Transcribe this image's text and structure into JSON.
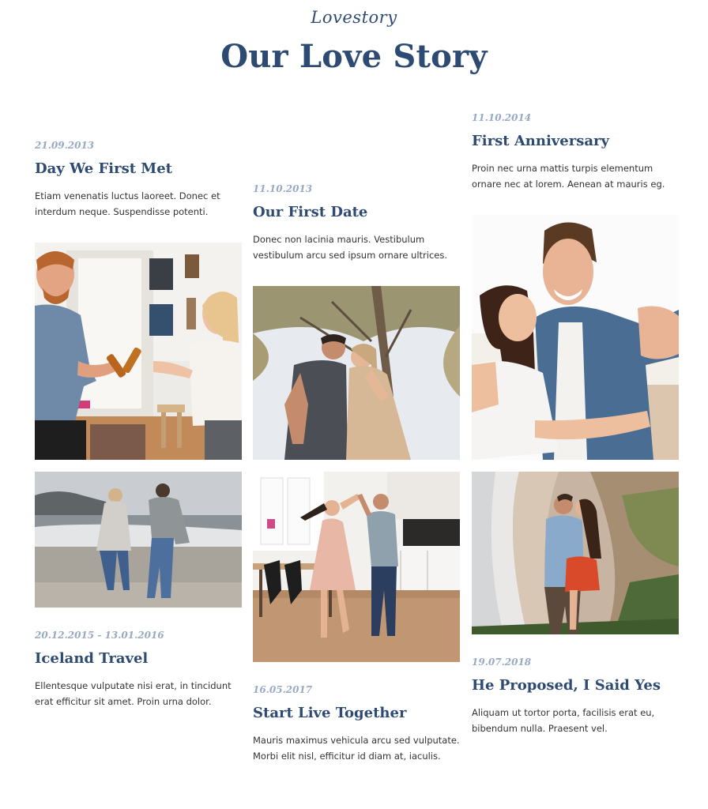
{
  "header": {
    "script_title": "Lovestory",
    "title": "Our Love Story"
  },
  "stories": {
    "first_met": {
      "date": "21.09.2013",
      "title": "Day We First Met",
      "text": "Etiam venenatis luctus laoreet. Donec et interdum neque. Suspendisse potenti."
    },
    "first_date": {
      "date": "11.10.2013",
      "title": "Our First Date",
      "text": "Donec non lacinia mauris. Vestibulum vestibulum arcu sed ipsum ornare ultrices."
    },
    "anniversary": {
      "date": "11.10.2014",
      "title": "First Anniversary",
      "text": "Proin nec urna mattis turpis elementum ornare nec at lorem. Aenean at mauris eg."
    },
    "iceland": {
      "date": "20.12.2015 - 13.01.2016",
      "title": "Iceland Travel",
      "text": "Ellentesque vulputate nisi erat, in tincidunt erat efficitur sit amet. Proin urna dolor."
    },
    "live_together": {
      "date": "16.05.2017",
      "title": "Start Live Together",
      "text": "Mauris maximus vehicula arcu sed vulputate. Morbi elit nisl, efficitur id diam at, iaculis."
    },
    "proposed": {
      "date": "19.07.2018",
      "title": "He Proposed, I Said Yes",
      "text": "Aliquam ut tortor porta, facilisis erat eu, bibendum nulla. Praesent vel."
    }
  },
  "colors": {
    "title": "#2d4a72",
    "date": "#98a9c4"
  }
}
